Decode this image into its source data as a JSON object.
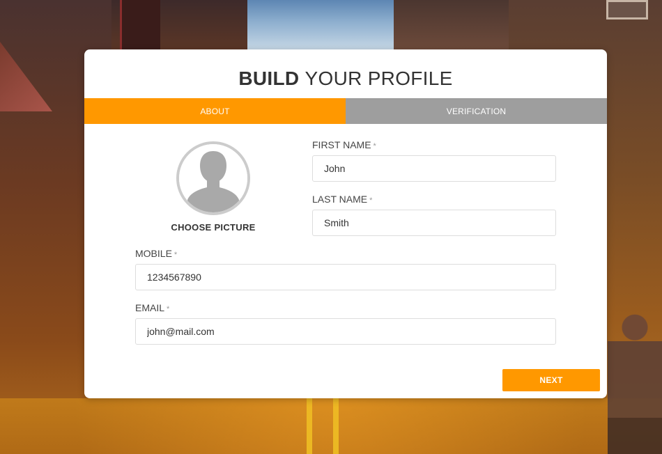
{
  "page": {
    "title_bold": "BUILD",
    "title_light": "YOUR PROFILE",
    "accent_color": "#ff9800",
    "inactive_tab_color": "#9e9e9e"
  },
  "tabs": [
    {
      "label": "ABOUT",
      "active": true
    },
    {
      "label": "VERIFICATION",
      "active": false
    }
  ],
  "avatar": {
    "icon": "user-silhouette-icon",
    "choose_label": "CHOOSE PICTURE"
  },
  "form": {
    "required_mark": "*",
    "first_name": {
      "label": "FIRST NAME",
      "value": "John"
    },
    "last_name": {
      "label": "LAST NAME",
      "value": "Smith"
    },
    "mobile": {
      "label": "MOBILE",
      "value": "1234567890"
    },
    "email": {
      "label": "EMAIL",
      "value": "john@mail.com"
    }
  },
  "actions": {
    "next_label": "NEXT"
  }
}
